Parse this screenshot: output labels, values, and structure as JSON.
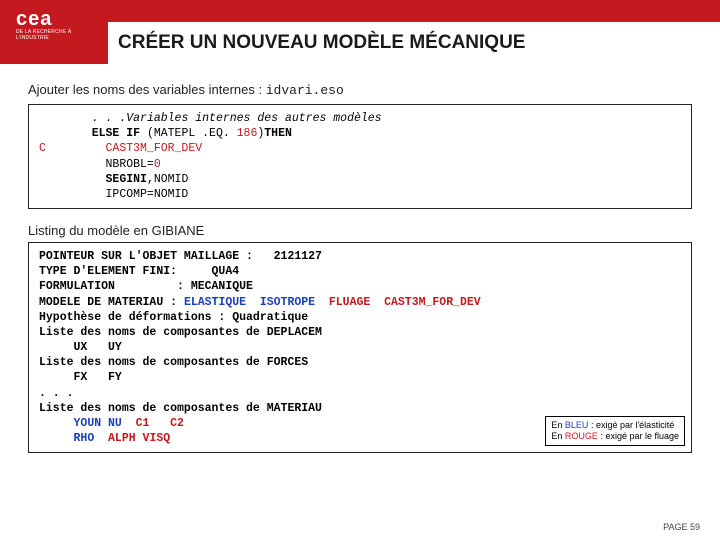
{
  "logo": {
    "name": "cea",
    "sub": "DE LA RECHERCHE À L'INDUSTRIE"
  },
  "title": "CRÉER UN NOUVEAU MODÈLE MÉCANIQUE",
  "intro": {
    "text": "Ajouter les noms des variables internes : ",
    "file": "idvari.eso"
  },
  "code1": {
    "l1a": ". . .",
    "l1b": "Variables internes des autres modèles",
    "l2a": "ELSE IF ",
    "l2b": "(MATEPL .EQ. ",
    "l2c": "186",
    "l2d": ")",
    "l2e": "THEN",
    "l3m": "C",
    "l3": "CAST3M_FOR_DEV",
    "l4a": "NBROBL=",
    "l4b": "0",
    "l5a": "SEGINI",
    "l5b": ",NOMID",
    "l6": "IPCOMP=NOMID"
  },
  "section2": "Listing du modèle en GIBIANE",
  "code2": {
    "l1": "POINTEUR SUR L'OBJET MAILLAGE :   2121127",
    "l2": "TYPE D'ELEMENT FINI:     QUA4",
    "l3": "FORMULATION         : MECANIQUE",
    "l4a": "MODELE DE MATERIAU : ",
    "l4b": "ELASTIQUE  ISOTROPE  ",
    "l4c": "FLUAGE  ",
    "l4d": "CAST3M_FOR_DEV",
    "l5": "Hypothèse de déformations : Quadratique",
    "l6": "Liste des noms de composantes de DEPLACEM",
    "l7": "     UX   UY",
    "l8": "Liste des noms de composantes de FORCES",
    "l9": "     FX   FY",
    "l10": ". . .",
    "l11": "Liste des noms de composantes de MATERIAU",
    "l12a": "     ",
    "l12b": "YOUN NU  ",
    "l12c": "C1   C2",
    "l13a": "     ",
    "l13b": "RHO  ",
    "l13c": "ALPH VISQ"
  },
  "legend": {
    "l1a": "En ",
    "l1b": "BLEU",
    "l1c": "    : exigé par l'élasticité",
    "l2a": "En ",
    "l2b": "ROUGE",
    "l2c": " : exigé par le fluage"
  },
  "footer": "PAGE 59"
}
